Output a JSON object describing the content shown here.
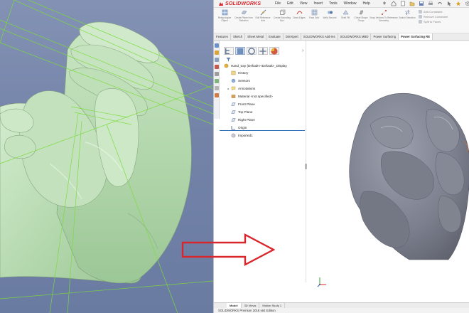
{
  "app": {
    "brand": "SOLIDWORKS",
    "menus": [
      "File",
      "Edit",
      "View",
      "Insert",
      "Tools",
      "Window",
      "Help"
    ]
  },
  "commands": [
    {
      "label": "Retopologize Object",
      "icon": "retopologize-icon"
    },
    {
      "label": "Create Plane from Selection",
      "icon": "plane-from-selection-icon"
    },
    {
      "label": "Edit Reference Axis",
      "icon": "reference-axis-icon"
    },
    {
      "label": "Create Bounding Box",
      "icon": "bounding-box-icon"
    },
    {
      "label": "Draw Edges",
      "icon": "draw-edges-icon"
    },
    {
      "label": "Face Grid",
      "icon": "face-grid-icon"
    },
    {
      "label": "Weld Second",
      "icon": "weld-icon"
    },
    {
      "label": "Shell Fill",
      "icon": "shell-fill-icon"
    },
    {
      "label": "Chisel Shape Group",
      "icon": "chisel-icon"
    },
    {
      "label": "Snap Vertices To Reference Geometry",
      "icon": "snap-vertices-icon"
    },
    {
      "label": "Switch Selection",
      "icon": "switch-selection-icon"
    }
  ],
  "side_commands": [
    "Add Constraint",
    "Remove Constraint",
    "Split to Faces"
  ],
  "tabs": [
    {
      "label": "Features",
      "active": false
    },
    {
      "label": "Sketch",
      "active": false
    },
    {
      "label": "Sheet Metal",
      "active": false
    },
    {
      "label": "Evaluate",
      "active": false
    },
    {
      "label": "DimXpert",
      "active": false
    },
    {
      "label": "SOLIDWORKS Add-Ins",
      "active": false
    },
    {
      "label": "SOLIDWORKS MBD",
      "active": false
    },
    {
      "label": "Power Surfacing",
      "active": false
    },
    {
      "label": "Power Surfacing RE",
      "active": true
    }
  ],
  "tree": {
    "root": "Hand_tray (Default<<Default>_Display",
    "items": [
      {
        "label": "History",
        "icon": "history-icon",
        "expander": ""
      },
      {
        "label": "Sensors",
        "icon": "sensors-icon",
        "expander": ""
      },
      {
        "label": "Annotations",
        "icon": "annotations-icon",
        "expander": "▸"
      },
      {
        "label": "Material <not specified>",
        "icon": "material-icon",
        "expander": ""
      },
      {
        "label": "Front Plane",
        "icon": "plane-icon",
        "expander": ""
      },
      {
        "label": "Top Plane",
        "icon": "plane-icon",
        "expander": ""
      },
      {
        "label": "Right Plane",
        "icon": "plane-icon",
        "expander": ""
      },
      {
        "label": "Origin",
        "icon": "origin-icon",
        "expander": ""
      },
      {
        "label": "Imported1",
        "icon": "imported-body-icon",
        "expander": ""
      }
    ]
  },
  "bottom_tabs": [
    {
      "label": "Model",
      "active": true
    },
    {
      "label": "3D Views",
      "active": false
    },
    {
      "label": "Motion Study 1",
      "active": false
    }
  ],
  "status": "SOLIDWORKS Premium 2018 x64 Edition",
  "colors": {
    "brand_red": "#d8242b",
    "mesh_green": "#b9dcb4",
    "wire_green": "#7bdc3a",
    "model_gray": "#7c808e",
    "arrow_red": "#d9262c",
    "viewport_blue": "#7b8bb0"
  }
}
